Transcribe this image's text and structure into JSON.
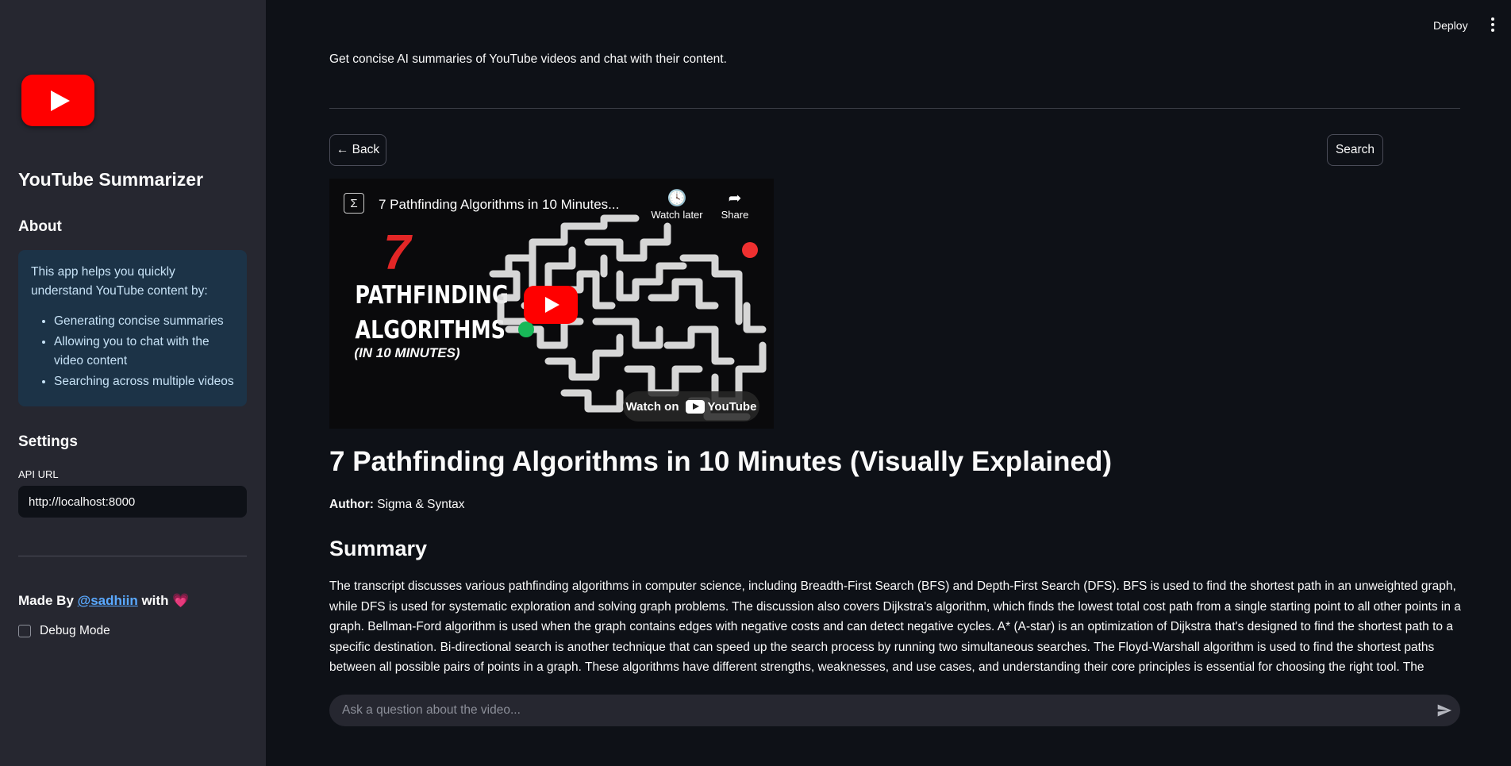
{
  "sidebar": {
    "app_title": "YouTube Summarizer",
    "about_heading": "About",
    "about_intro": "This app helps you quickly understand YouTube content by:",
    "about_items": [
      "Generating concise summaries",
      "Allowing you to chat with the video content",
      "Searching across multiple videos"
    ],
    "settings_heading": "Settings",
    "api_label": "API URL",
    "api_value": "http://localhost:8000",
    "made_by_prefix": "Made By ",
    "made_by_handle": "@sadhiin",
    "made_by_suffix": " with ",
    "heart": "💗",
    "debug_label": "Debug Mode"
  },
  "header": {
    "deploy_label": "Deploy"
  },
  "main": {
    "tagline": "Get concise AI summaries of YouTube videos and chat with their content.",
    "back_label": "← Back",
    "search_label": "Search",
    "video": {
      "embed_title": "7 Pathfinding Algorithms in 10 Minutes...",
      "watch_later": "Watch later",
      "share": "Share",
      "thumb_number": "7",
      "thumb_line1": "PATHFINDING",
      "thumb_line2": "ALGORITHMS",
      "thumb_line3": "(IN 10 MINUTES)",
      "watch_on": "Watch on",
      "youtube": "YouTube"
    },
    "title": "7 Pathfinding Algorithms in 10 Minutes (Visually Explained)",
    "author_label": "Author:",
    "author_value": "Sigma & Syntax",
    "summary_heading": "Summary",
    "summary_text": "The transcript discusses various pathfinding algorithms in computer science, including Breadth-First Search (BFS) and Depth-First Search (DFS). BFS is used to find the shortest path in an unweighted graph, while DFS is used for systematic exploration and solving graph problems. The discussion also covers Dijkstra's algorithm, which finds the lowest total cost path from a single starting point to all other points in a graph. Bellman-Ford algorithm is used when the graph contains edges with negative costs and can detect negative cycles. A* (A-star) is an optimization of Dijkstra that's designed to find the shortest path to a specific destination. Bi-directional search is another technique that can speed up the search process by running two simultaneous searches. The Floyd-Warshall algorithm is used to find the shortest paths between all possible pairs of points in a graph. These algorithms have different strengths, weaknesses, and use cases, and understanding their core principles is essential for choosing the right tool. The speaker concludes by",
    "chat_placeholder": "Ask a question about the video..."
  }
}
